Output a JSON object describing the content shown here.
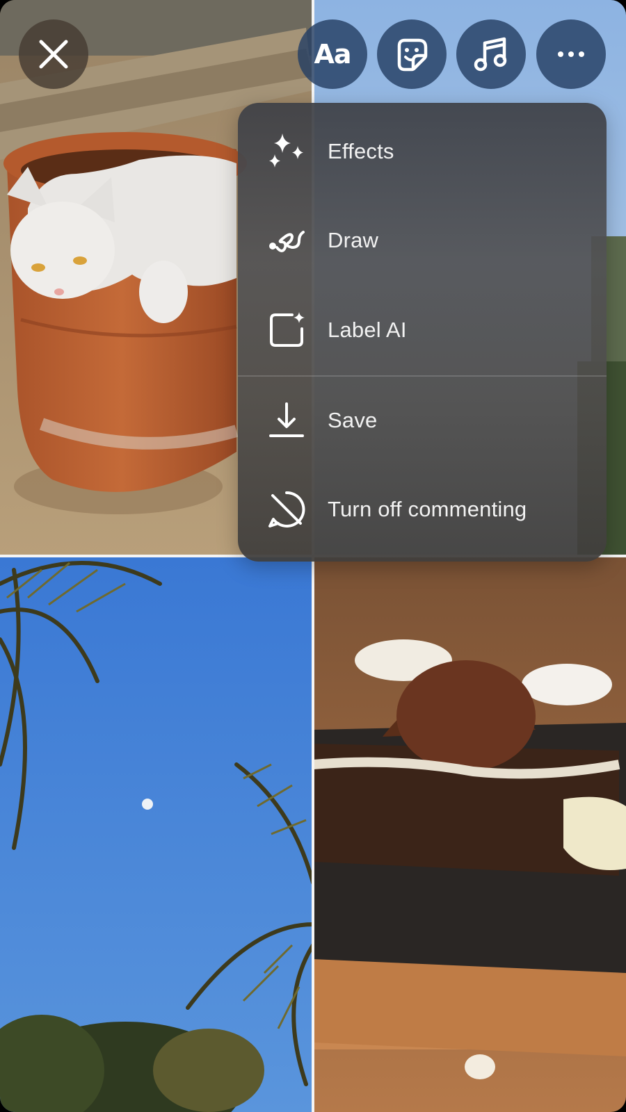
{
  "toolbar": {
    "close_icon": "close-icon",
    "text_button_label": "Aa",
    "sticker_icon": "sticker-icon",
    "music_icon": "music-note-icon",
    "more_icon": "more-horizontal-icon"
  },
  "menu": {
    "items": [
      {
        "label": "Effects",
        "icon": "sparkles-icon"
      },
      {
        "label": "Draw",
        "icon": "squiggle-draw-icon"
      },
      {
        "label": "Label AI",
        "icon": "label-ai-icon"
      },
      {
        "label": "Save",
        "icon": "download-icon"
      },
      {
        "label": "Turn off commenting",
        "icon": "comment-off-icon"
      }
    ]
  },
  "colors": {
    "button_blue": "#264064",
    "button_brown": "#463c32",
    "menu_bg": "#4f4f52",
    "menu_text": "#f2f2f2"
  }
}
